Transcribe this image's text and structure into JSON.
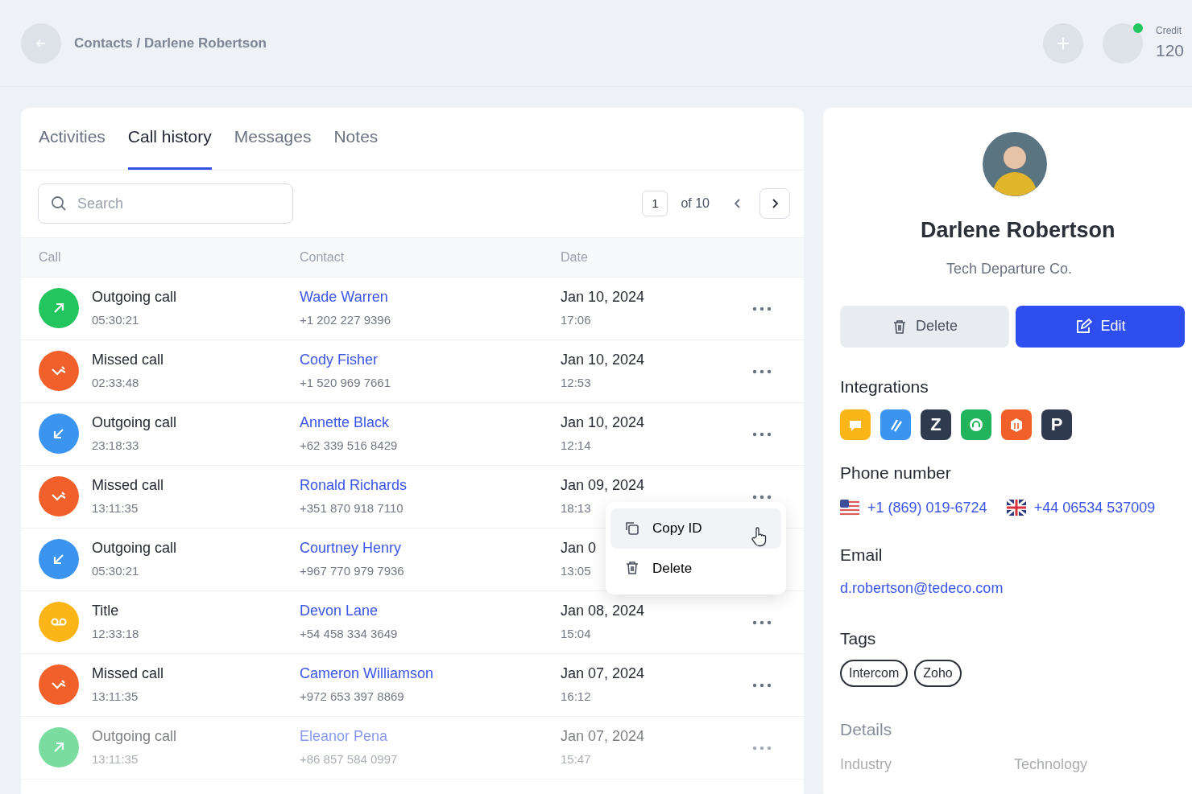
{
  "header": {
    "breadcrumb": "Contacts / Darlene Robertson",
    "credit_label": "Credit",
    "credit_value": "120"
  },
  "tabs": [
    {
      "label": "Activities",
      "selected": false
    },
    {
      "label": "Call history",
      "selected": true
    },
    {
      "label": "Messages",
      "selected": false
    },
    {
      "label": "Notes",
      "selected": false
    }
  ],
  "search": {
    "placeholder": "Search"
  },
  "pagination": {
    "page": "1",
    "of": "of 10"
  },
  "table": {
    "columns": [
      "Call",
      "Contact",
      "Date"
    ],
    "rows": [
      {
        "kind": "outgoing",
        "type": "Outgoing call",
        "duration": "05:30:21",
        "name": "Wade Warren",
        "phone": "+1 202 227 9396",
        "date": "Jan 10, 2024",
        "time": "17:06"
      },
      {
        "kind": "missed",
        "type": "Missed call",
        "duration": "02:33:48",
        "name": "Cody Fisher",
        "phone": "+1 520 969 7661",
        "date": "Jan 10, 2024",
        "time": "12:53"
      },
      {
        "kind": "incoming",
        "type": "Outgoing call",
        "duration": "23:18:33",
        "name": "Annette Black",
        "phone": "+62 339 516 8429",
        "date": "Jan 10, 2024",
        "time": "12:14"
      },
      {
        "kind": "missed",
        "type": "Missed call",
        "duration": "13:11:35",
        "name": "Ronald Richards",
        "phone": "+351 870 918 7110",
        "date": "Jan 09, 2024",
        "time": "18:13"
      },
      {
        "kind": "incoming",
        "type": "Outgoing call",
        "duration": "05:30:21",
        "name": "Courtney Henry",
        "phone": "+967 770 979 7936",
        "date": "Jan 0",
        "time": "13:05",
        "actions_hidden": true
      },
      {
        "kind": "voicemail",
        "type": "Title",
        "duration": "12:33:18",
        "name": "Devon Lane",
        "phone": "+54 458 334 3649",
        "date": "Jan 08, 2024",
        "time": "15:04"
      },
      {
        "kind": "missed",
        "type": "Missed call",
        "duration": "13:11:35",
        "name": "Cameron Williamson",
        "phone": "+972 653 397 8869",
        "date": "Jan 07, 2024",
        "time": "16:12"
      },
      {
        "kind": "outgoing",
        "type": "Outgoing call",
        "duration": "13:11:35",
        "name": "Eleanor Pena",
        "phone": "+86 857 584 0997",
        "date": "Jan 07, 2024",
        "time": "15:47"
      }
    ]
  },
  "row_menu": {
    "items": [
      {
        "kind": "copy",
        "label": "Copy ID",
        "highlighted": true
      },
      {
        "kind": "delete",
        "label": "Delete",
        "highlighted": false
      }
    ]
  },
  "profile": {
    "name": "Darlene Robertson",
    "company": "Tech Departure Co.",
    "buttons": [
      {
        "kind": "delete",
        "label": "Delete"
      },
      {
        "kind": "edit",
        "label": "Edit"
      }
    ],
    "integrations_title": "Integrations",
    "integrations": [
      {
        "kind": "bubble",
        "color": "#fbb516"
      },
      {
        "kind": "slashes",
        "color": "#3b95f0"
      },
      {
        "kind": "letter",
        "text": "Z",
        "color": "#2f3a4f"
      },
      {
        "kind": "headset",
        "color": "#22b45c"
      },
      {
        "kind": "shield",
        "color": "#f1602a"
      },
      {
        "kind": "letter",
        "text": "P",
        "color": "#2f3a4f"
      }
    ],
    "phone_title": "Phone number",
    "phones": [
      {
        "kind": "us",
        "number": "+1 (869) 019-6724"
      },
      {
        "kind": "uk",
        "number": "+44 06534 537009"
      }
    ],
    "email_title": "Email",
    "email": "d.robertson@tedeco.com",
    "tags_title": "Tags",
    "tags": [
      "Intercom",
      "Zoho"
    ],
    "details_title": "Details",
    "details": [
      {
        "label": "Industry",
        "value": "Technology"
      }
    ]
  }
}
